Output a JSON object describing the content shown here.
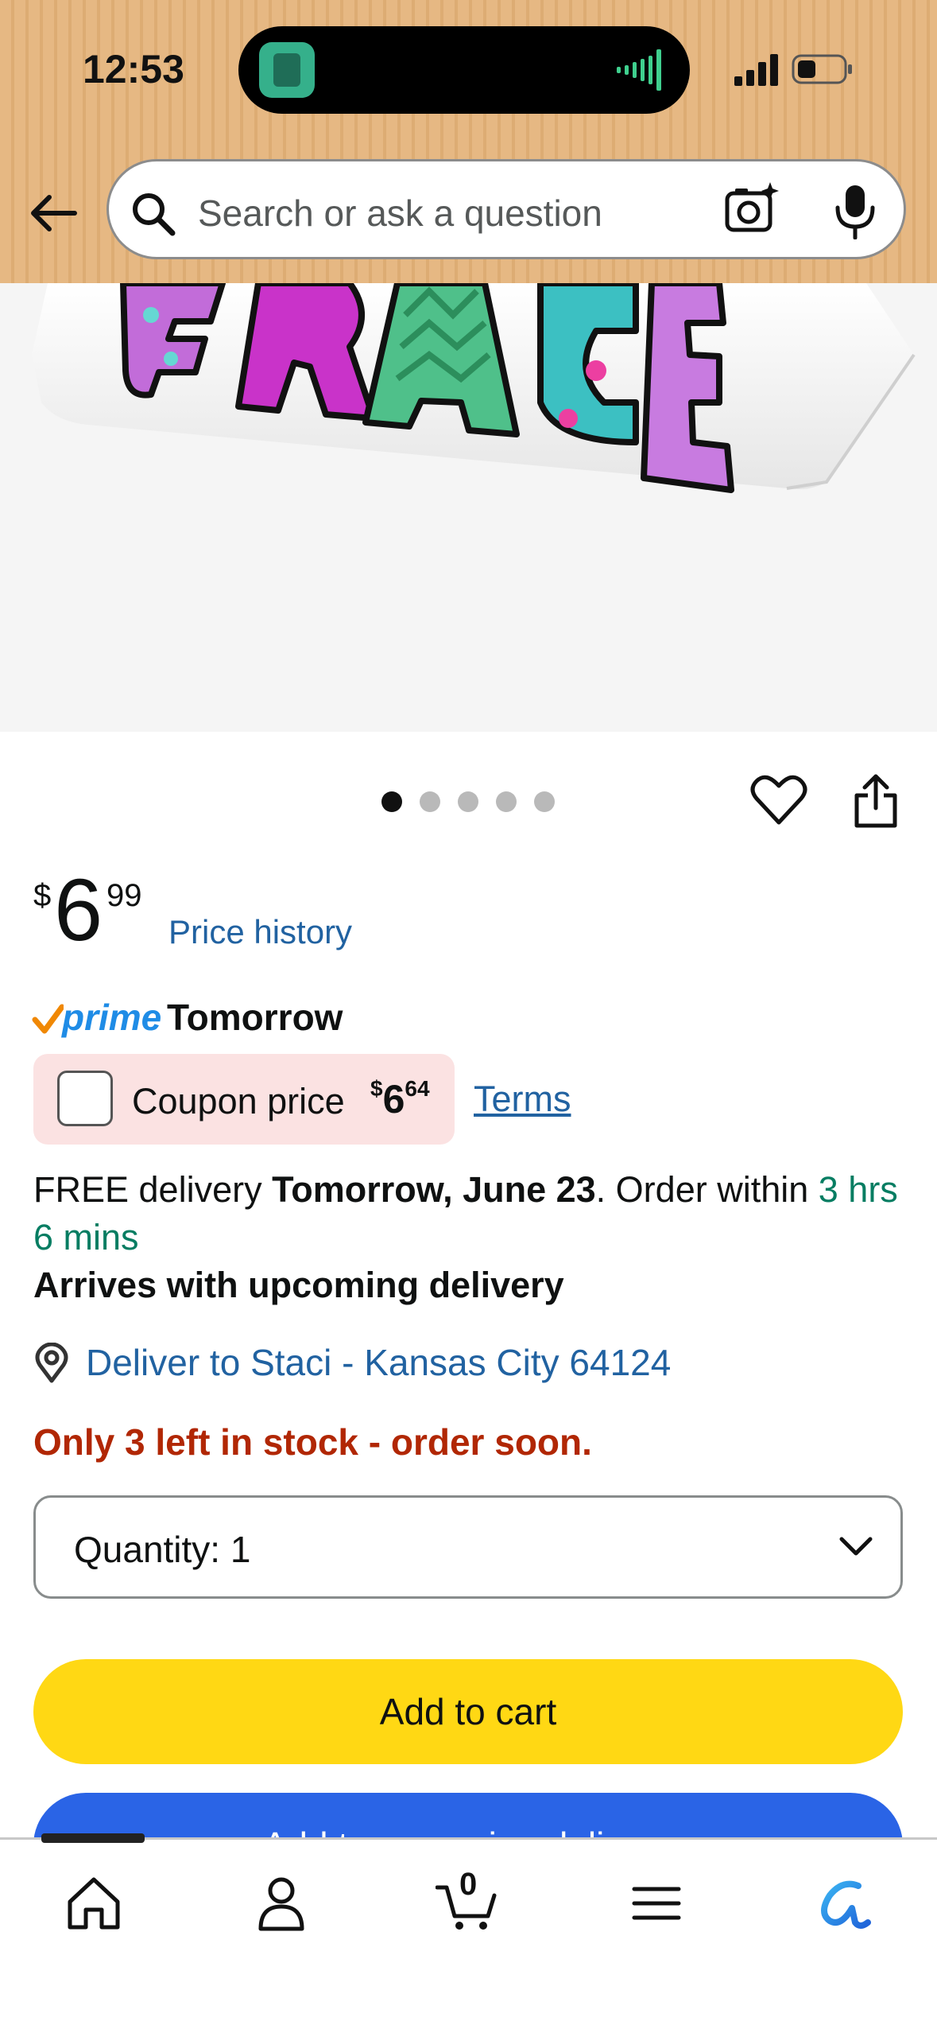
{
  "status_bar": {
    "time": "12:53"
  },
  "header": {
    "back_icon": "back-arrow-icon",
    "search": {
      "placeholder": "Search or ask a question",
      "search_icon": "search-icon",
      "camera_icon": "camera-icon",
      "mic_icon": "microphone-icon"
    }
  },
  "product_image": {
    "visible_text": "GRACE",
    "image_dots": {
      "count": 5,
      "active_index": 0
    }
  },
  "price": {
    "symbol": "$",
    "whole": "6",
    "fraction": "99",
    "history_link": "Price history"
  },
  "prime": {
    "badge": "prime",
    "delivery_day": "Tomorrow"
  },
  "coupon": {
    "label": "Coupon price",
    "price_symbol": "$",
    "price_whole": "6",
    "price_fraction": "64",
    "terms_link": "Terms",
    "checked": false
  },
  "delivery": {
    "prefix": "FREE delivery ",
    "date": "Tomorrow, June 23",
    "order_within_prefix": ". Order within ",
    "countdown": "3 hrs 6 mins",
    "arrives_note": "Arrives with upcoming delivery",
    "location": "Deliver to Staci - Kansas City 64124"
  },
  "stock_warning": "Only 3 left in stock - order soon.",
  "quantity": {
    "label": "Quantity:",
    "value": "1"
  },
  "buttons": {
    "add_to_cart": "Add to cart",
    "add_to_delivery": "Add to upcoming delivery"
  },
  "tabbar": {
    "items": [
      "home-icon",
      "account-icon",
      "cart-icon",
      "menu-icon",
      "rufus-icon"
    ],
    "cart_count": "0"
  },
  "colors": {
    "header": "#e6b883",
    "link": "#2162a1",
    "prime": "#1f8ce6",
    "stock": "#b12704",
    "countdown": "#067d62",
    "add_to_cart": "#ffd814",
    "add_to_delivery": "#2a64e6",
    "coupon_bg": "#fbe2e2"
  }
}
